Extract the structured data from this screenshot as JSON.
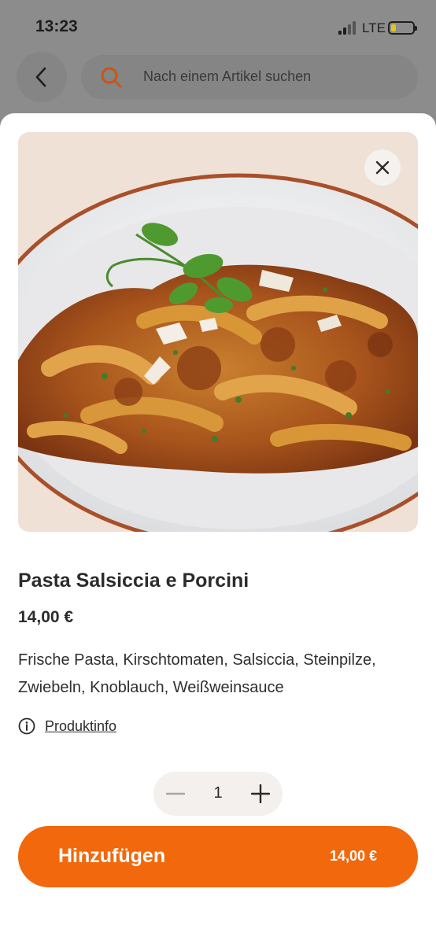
{
  "status_bar": {
    "time": "13:23",
    "network": "LTE",
    "icons": [
      "signal-icon",
      "battery-icon"
    ]
  },
  "header": {
    "back_icon": "chevron-left-icon",
    "search": {
      "icon": "search-icon",
      "placeholder": "Nach einem Artikel suchen"
    }
  },
  "product": {
    "image_icon": "close-icon",
    "title": "Pasta Salsiccia e Porcini",
    "price": "14,00 €",
    "description": "Frische Pasta, Kirschtomaten, Salsiccia, Steinpilze, Zwiebeln, Knoblauch, Weißweinsauce",
    "info_icon": "info-icon",
    "info_link": "Produktinfo"
  },
  "quantity": {
    "value": "1",
    "minus_icon": "minus-icon",
    "plus_icon": "plus-icon"
  },
  "cta": {
    "label": "Hinzufügen",
    "price": "14,00 €"
  },
  "colors": {
    "accent": "#f2680c",
    "search_icon": "#c9560f",
    "overlay": "#8c8c8c",
    "sheet": "#ffffff"
  }
}
